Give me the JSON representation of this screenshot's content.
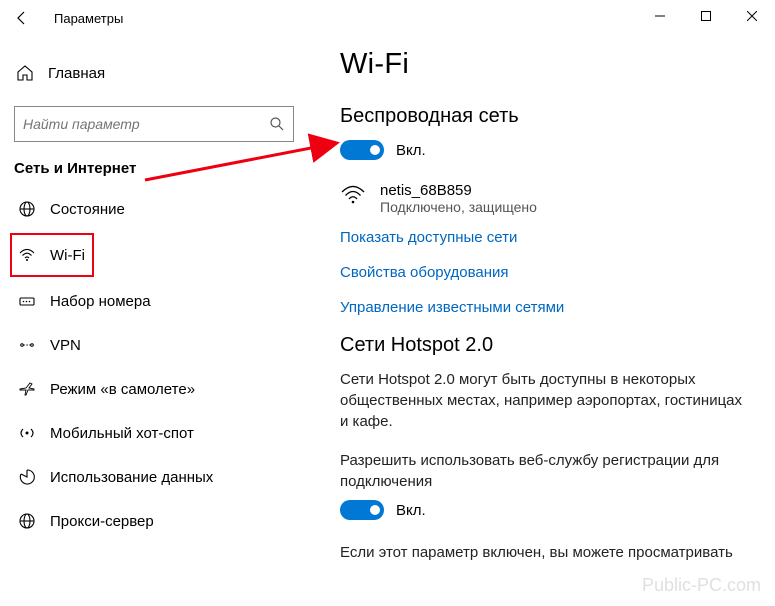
{
  "titlebar": {
    "title": "Параметры"
  },
  "sidebar": {
    "home": "Главная",
    "search_placeholder": "Найти параметр",
    "category": "Сеть и Интернет",
    "items": [
      {
        "icon": "globe",
        "label": "Состояние"
      },
      {
        "icon": "wifi",
        "label": "Wi-Fi",
        "selected": true
      },
      {
        "icon": "dialup",
        "label": "Набор номера"
      },
      {
        "icon": "vpn",
        "label": "VPN"
      },
      {
        "icon": "airplane",
        "label": "Режим «в самолете»"
      },
      {
        "icon": "hotspot",
        "label": "Мобильный хот-спот"
      },
      {
        "icon": "datausage",
        "label": "Использование данных"
      },
      {
        "icon": "proxy",
        "label": "Прокси-сервер"
      }
    ]
  },
  "main": {
    "title": "Wi-Fi",
    "wireless": {
      "heading": "Беспроводная сеть",
      "toggle_label": "Вкл.",
      "network_name": "netis_68B859",
      "network_status": "Подключено, защищено",
      "link_networks": "Показать доступные сети",
      "link_hardware": "Свойства оборудования",
      "link_known": "Управление известными сетями"
    },
    "hotspot": {
      "heading": "Сети Hotspot 2.0",
      "description": "Сети Hotspot 2.0 могут быть доступны в некоторых общественных местах, например аэропортах, гостиницах и кафе.",
      "permit_label": "Разрешить использовать веб-службу регистрации для подключения",
      "toggle_label": "Вкл.",
      "footer": "Если этот параметр включен, вы можете просматривать"
    }
  },
  "watermark": "Public-PC.com"
}
